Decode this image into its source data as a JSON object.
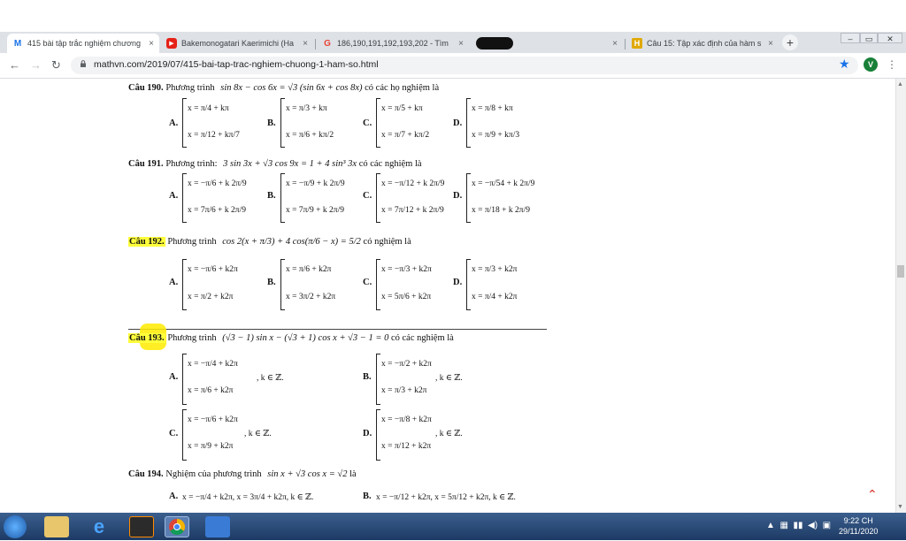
{
  "browser": {
    "tabs": [
      {
        "icon": "M",
        "title": "415 bài tập trắc nghiệm chương",
        "active": true
      },
      {
        "icon": "▶",
        "title": "Bakemonogatari Kaerimichi (Ha",
        "active": false
      },
      {
        "icon": "G",
        "title": "186,190,191,192,193,202 - Tìm",
        "active": false
      },
      {
        "icon": "",
        "title": "",
        "active": false
      },
      {
        "icon": "H",
        "title": "Câu 15: Tập xác định của hàm s",
        "active": false
      }
    ],
    "new_tab": "+",
    "close": "×",
    "url": "mathvn.com/2019/07/415-bai-tap-trac-nghiem-chuong-1-ham-so.html",
    "avatar_letter": "V",
    "window_buttons": [
      "–",
      "▭",
      "✕"
    ]
  },
  "page": {
    "q190": {
      "label": "Câu 190.",
      "text": "Phương trình",
      "eq": "sin 8x − cos 6x = √3 (sin 6x + cos 8x)",
      "tail": "có các họ nghiệm là",
      "options": [
        {
          "letter": "A.",
          "l1": "x = π/4 + kπ",
          "l2": "x = π/12 + kπ/7"
        },
        {
          "letter": "B.",
          "l1": "x = π/3 + kπ",
          "l2": "x = π/6 + kπ/2"
        },
        {
          "letter": "C.",
          "l1": "x = π/5 + kπ",
          "l2": "x = π/7 + kπ/2"
        },
        {
          "letter": "D.",
          "l1": "x = π/8 + kπ",
          "l2": "x = π/9 + kπ/3"
        }
      ]
    },
    "q191": {
      "label": "Câu 191.",
      "text": "Phương trình:",
      "eq": "3 sin 3x + √3 cos 9x = 1 + 4 sin³ 3x",
      "tail": "có các nghiệm là",
      "options": [
        {
          "letter": "A.",
          "l1": "x = −π/6 + k 2π/9",
          "l2": "x = 7π/6 + k 2π/9"
        },
        {
          "letter": "B.",
          "l1": "x = −π/9 + k 2π/9",
          "l2": "x = 7π/9 + k 2π/9"
        },
        {
          "letter": "C.",
          "l1": "x = −π/12 + k 2π/9",
          "l2": "x = 7π/12 + k 2π/9"
        },
        {
          "letter": "D.",
          "l1": "x = −π/54 + k 2π/9",
          "l2": "x = π/18 + k 2π/9"
        }
      ]
    },
    "q192": {
      "label": "Câu 192.",
      "text": "Phương trình",
      "eq": "cos 2(x + π/3) + 4 cos(π/6 − x) = 5/2",
      "tail": "có nghiệm là",
      "options": [
        {
          "letter": "A.",
          "l1": "x = −π/6 + k2π",
          "l2": "x = π/2 + k2π"
        },
        {
          "letter": "B.",
          "l1": "x = π/6 + k2π",
          "l2": "x = 3π/2 + k2π"
        },
        {
          "letter": "C.",
          "l1": "x = −π/3 + k2π",
          "l2": "x = 5π/6 + k2π"
        },
        {
          "letter": "D.",
          "l1": "x = π/3 + k2π",
          "l2": "x = π/4 + k2π"
        }
      ]
    },
    "q193": {
      "label": "Câu 193.",
      "text": "Phương trình",
      "eq": "(√3 − 1) sin x − (√3 + 1) cos x + √3 − 1 = 0",
      "tail": "có các nghiệm là",
      "options": [
        {
          "letter": "A.",
          "l1": "x = −π/4 + k2π",
          "l2": "x = π/6 + k2π",
          "suffix": ", k ∈ ℤ."
        },
        {
          "letter": "B.",
          "l1": "x = −π/2 + k2π",
          "l2": "x = π/3 + k2π",
          "suffix": ", k ∈ ℤ."
        },
        {
          "letter": "C.",
          "l1": "x = −π/6 + k2π",
          "l2": "x = π/9 + k2π",
          "suffix": ", k ∈ ℤ."
        },
        {
          "letter": "D.",
          "l1": "x = −π/8 + k2π",
          "l2": "x = π/12 + k2π",
          "suffix": ", k ∈ ℤ."
        }
      ]
    },
    "q194": {
      "label": "Câu 194.",
      "text": "Nghiệm của phương trình",
      "eq": "sin x + √3 cos x = √2",
      "tail": "là",
      "options": [
        {
          "letter": "A.",
          "l1": "x = −π/4 + k2π, x = 3π/4 + k2π, k ∈ ℤ."
        },
        {
          "letter": "B.",
          "l1": "x = −π/12 + k2π, x = 5π/12 + k2π, k ∈ ℤ."
        }
      ]
    }
  },
  "taskbar": {
    "time": "9:22 CH",
    "date": "29/11/2020"
  },
  "colors": {
    "highlight": "#ffff3b",
    "tab_bar": "#dee1e6",
    "accent": "#1a73e8"
  }
}
